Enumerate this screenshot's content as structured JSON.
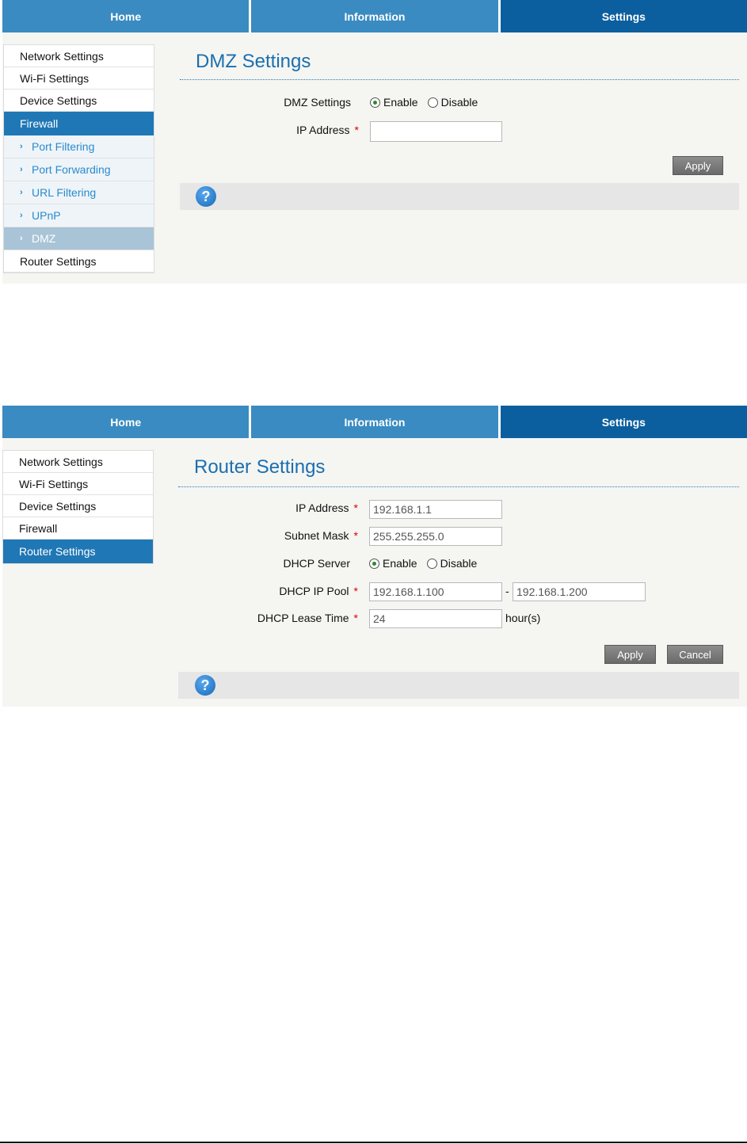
{
  "nav": {
    "home": "Home",
    "information": "Information",
    "settings": "Settings"
  },
  "sidebar": {
    "network": "Network Settings",
    "wifi": "Wi-Fi Settings",
    "device": "Device Settings",
    "firewall": "Firewall",
    "router": "Router Settings",
    "firewall_sub": [
      "Port Filtering",
      "Port Forwarding",
      "URL Filtering",
      "UPnP",
      "DMZ"
    ]
  },
  "dmz": {
    "title": "DMZ Settings",
    "dmz_label": "DMZ Settings",
    "enable": "Enable",
    "disable": "Disable",
    "ip_label": "IP Address",
    "ip_value": "",
    "apply": "Apply",
    "selected": "Enable"
  },
  "router": {
    "title": "Router Settings",
    "ip_label": "IP Address",
    "ip_value": "192.168.1.1",
    "mask_label": "Subnet Mask",
    "mask_value": "255.255.255.0",
    "dhcp_label": "DHCP Server",
    "enable": "Enable",
    "disable": "Disable",
    "selected": "Enable",
    "pool_label": "DHCP IP Pool",
    "pool_start": "192.168.1.100",
    "pool_sep": "-",
    "pool_end": "192.168.1.200",
    "lease_label": "DHCP Lease Time",
    "lease_value": "24",
    "lease_unit": "hour(s)",
    "apply": "Apply",
    "cancel": "Cancel"
  },
  "required_mark": "*",
  "help_glyph": "?",
  "colors": {
    "nav": "#3a8bc1",
    "nav_active": "#0c5f9e",
    "title": "#1a6fb0",
    "sub_link": "#2a8ad0"
  }
}
